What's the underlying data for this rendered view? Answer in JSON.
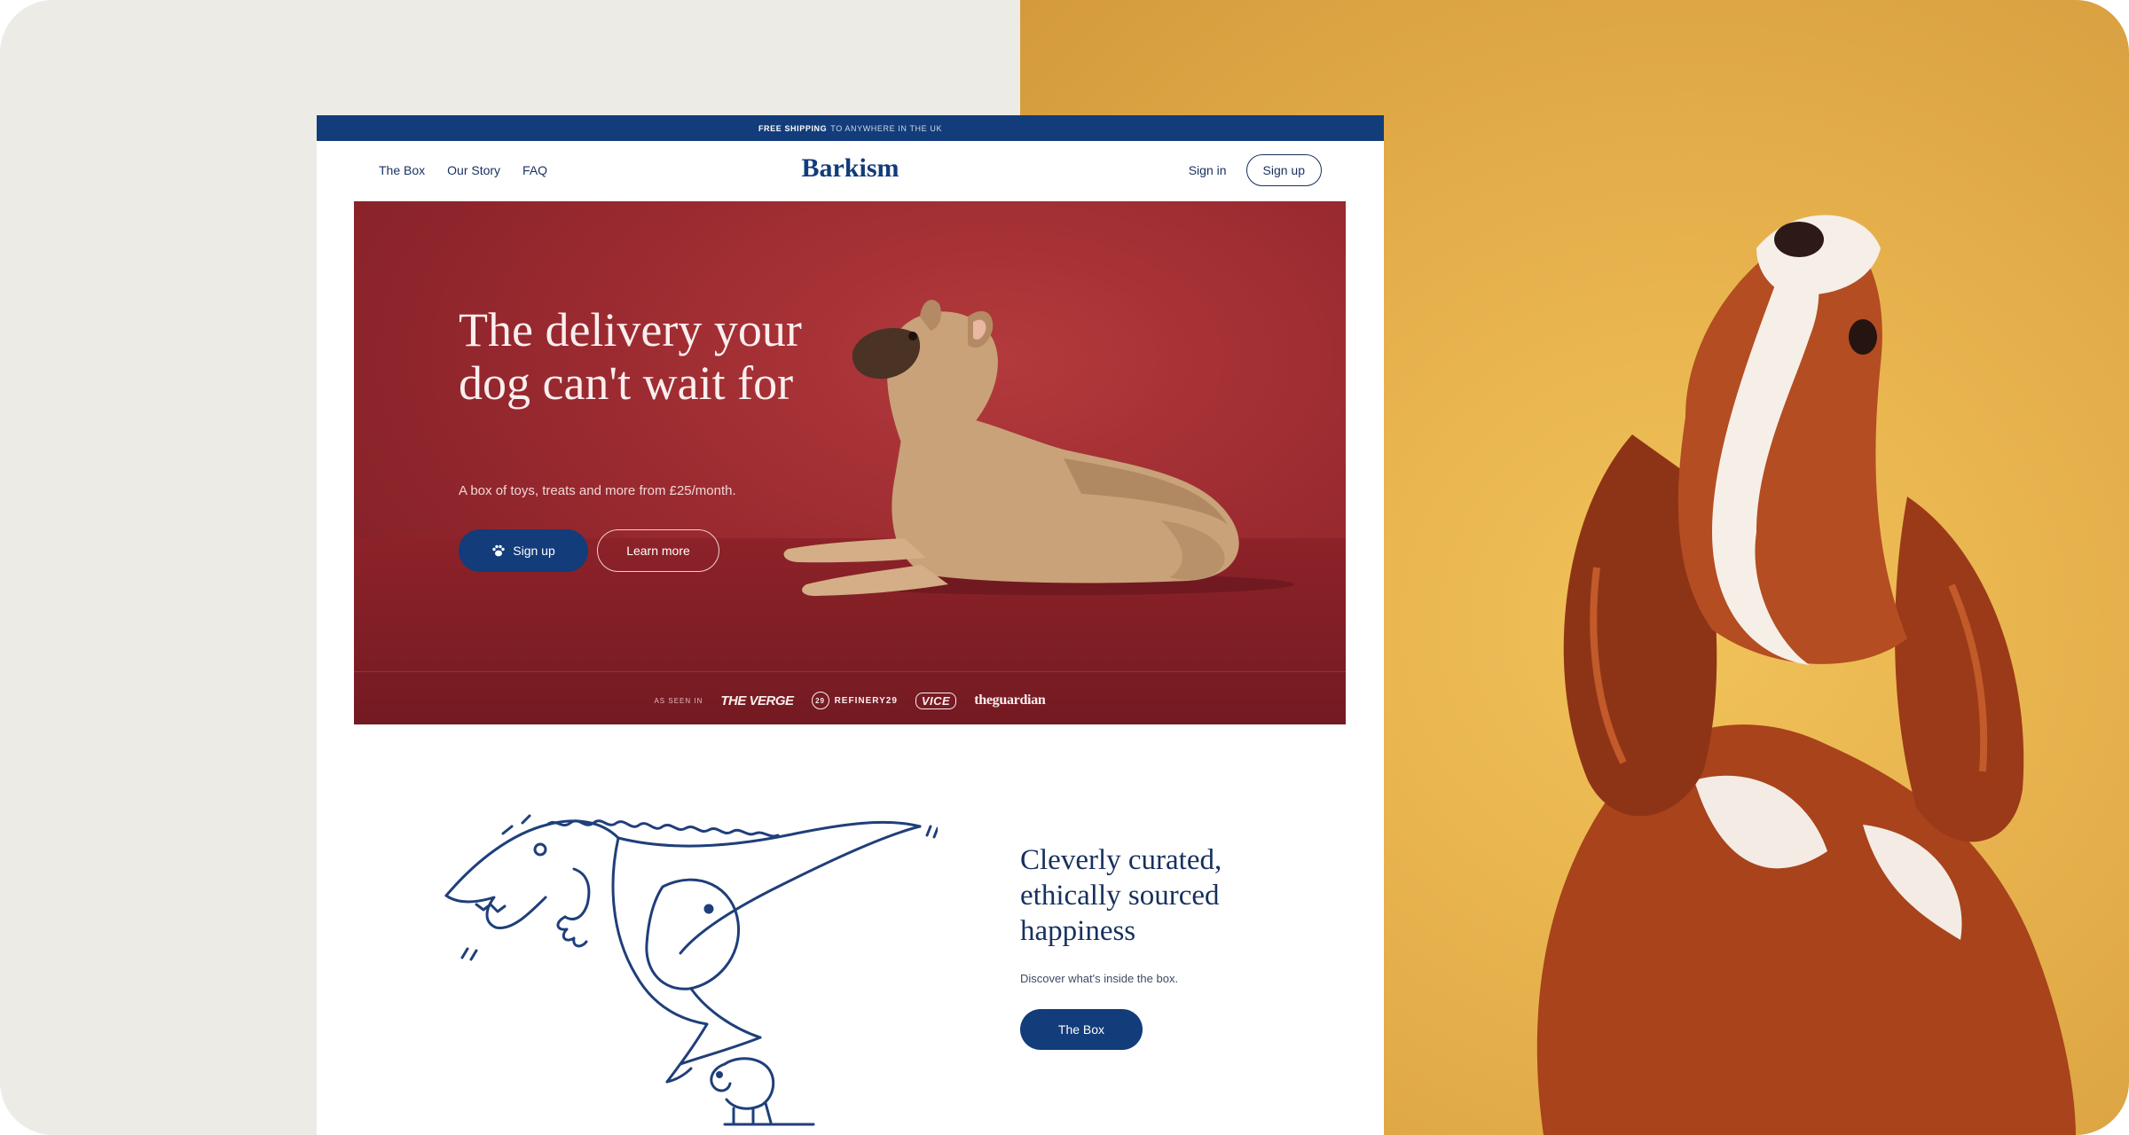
{
  "topbar": {
    "bold": "FREE SHIPPING",
    "rest": "TO ANYWHERE IN THE UK"
  },
  "nav": {
    "links": [
      "The Box",
      "Our Story",
      "FAQ"
    ],
    "logo": "Barkism",
    "signin": "Sign in",
    "signup": "Sign up"
  },
  "hero": {
    "title": "The delivery your dog can't wait for",
    "subtitle": "A box of toys, treats and more from £25/month.",
    "primary_button": "Sign up",
    "secondary_button": "Learn more",
    "press_label": "AS SEEN IN",
    "press": [
      "THE VERGE",
      "REFINERY29",
      "VICE",
      "theguardian"
    ]
  },
  "feature": {
    "title": "Cleverly curated, ethically sourced happiness",
    "description": "Discover what's inside the box.",
    "button": "The Box"
  },
  "colors": {
    "brand_blue": "#123c7a",
    "hero_red": "#9a2a30",
    "backdrop_yellow": "#e6b14c",
    "backdrop_grey": "#ecebe6"
  },
  "icons": {
    "paw": "paw-icon"
  }
}
